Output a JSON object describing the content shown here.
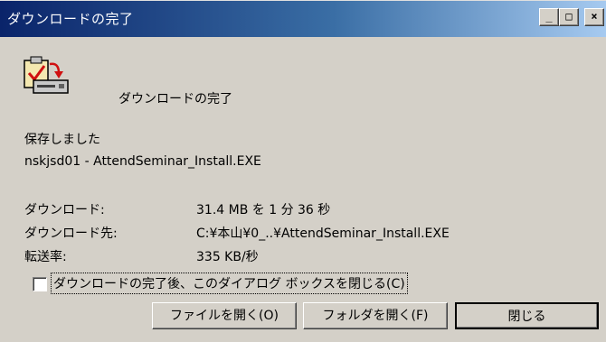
{
  "window": {
    "title": "ダウンロードの完了",
    "minimize_label": "_",
    "maximize_label": "□",
    "close_label": "×"
  },
  "header": {
    "icon": "download-complete-icon",
    "title": "ダウンロードの完了"
  },
  "status": {
    "saved_text": "保存しました",
    "filename": "nskjsd01 - AttendSeminar_Install.EXE"
  },
  "details": {
    "download_label": "ダウンロード:",
    "download_value": "31.4 MB を 1 分 36 秒",
    "destination_label": "ダウンロード先:",
    "destination_value": "C:¥本山¥0_..¥AttendSeminar_Install.EXE",
    "rate_label": "転送率:",
    "rate_value": "335 KB/秒"
  },
  "options": {
    "close_on_complete_label": "ダウンロードの完了後、このダイアログ ボックスを閉じる(C)",
    "close_on_complete_checked": false
  },
  "buttons": {
    "open_file": "ファイルを開く(O)",
    "open_folder": "フォルダを開く(F)",
    "close": "閉じる"
  }
}
